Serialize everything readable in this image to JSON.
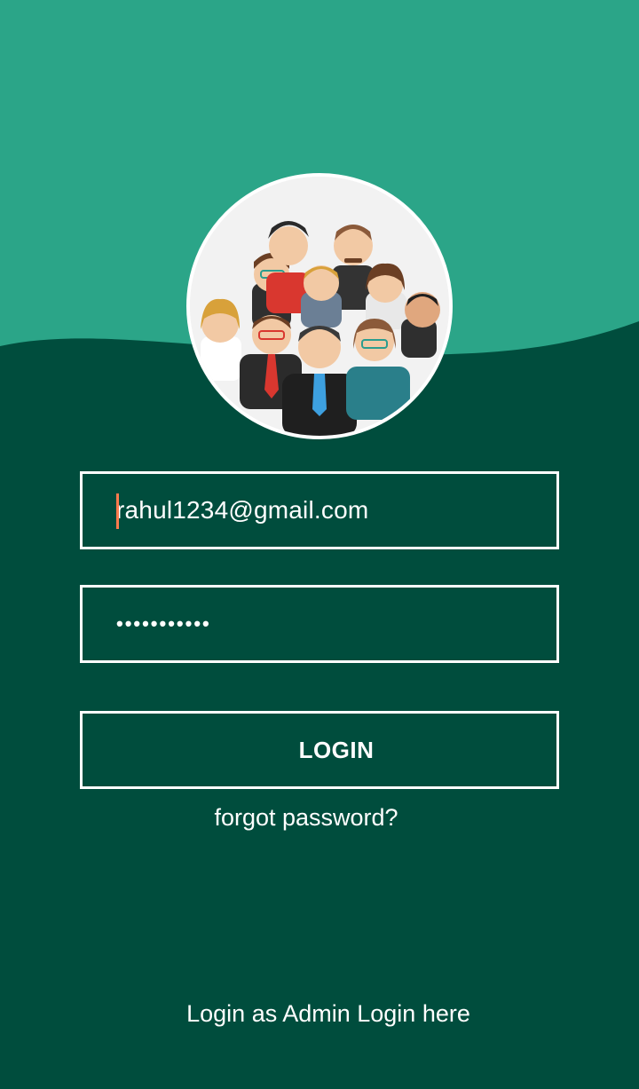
{
  "colors": {
    "header": "#2BA588",
    "background": "#004D3D",
    "caret": "#FF7A4D",
    "text": "#FFFFFF"
  },
  "avatar": {
    "icon": "group-of-people-illustration"
  },
  "form": {
    "email_value": "rahul1234@gmail.com",
    "password_value": "•••••••••••",
    "login_label": "LOGIN",
    "forgot_label": "forgot password?"
  },
  "footer": {
    "admin_link": "Login as Admin Login here"
  }
}
